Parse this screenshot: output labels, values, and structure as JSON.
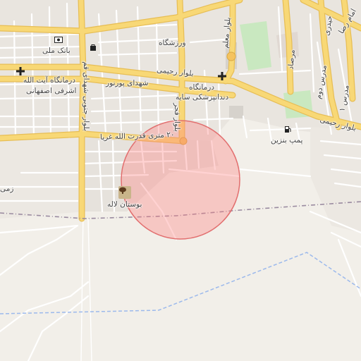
{
  "map": {
    "labels": {
      "bank": "بانک ملی",
      "clinic_ayatollah_1": "درمانگاه آیت الله",
      "clinic_ayatollah_2": "اشرفی اصفهانی",
      "sports": "ورزشگاه",
      "rahimi_blvd_left": "بلوار رحیمی",
      "rahimi_blvd_right": "بلوار رحیمی",
      "pournour": "شهدای پورنور",
      "clinic_saye_1": "درمانگاه",
      "clinic_saye_2": "دندانپزشکی سایه",
      "qodratollah": "۲۰ متری قدرت الله غریا",
      "fajr_blvd": "بلوار فجر",
      "shohada_south": "بلوار جنوبی شهدای قم",
      "moallem": "بلوار معلم",
      "gas_station": "پمپ بنزین",
      "boostan": "بوستان لاله",
      "zam": "زمی",
      "mersad": "مرصاد",
      "modarres": "مدرس ۱",
      "modarres2": "مدرس دوم",
      "jami": "حیدری",
      "emam": "امام رضا"
    },
    "icons": [
      "bank-icon",
      "shopping-icon",
      "hospital-icon",
      "hospital-icon",
      "fuel-icon",
      "park-icon"
    ],
    "colors": {
      "background": "#f2efe9",
      "major_road": "#f7d570",
      "major_road_casing": "#e9bf55",
      "minor_road": "#ffffff",
      "park": "#c9e8c0",
      "railway": "#9a8ba0",
      "boundary": "#9cb9ec",
      "circle_fill": "#ff7f7f",
      "circle_stroke": "#e26f6f"
    }
  }
}
